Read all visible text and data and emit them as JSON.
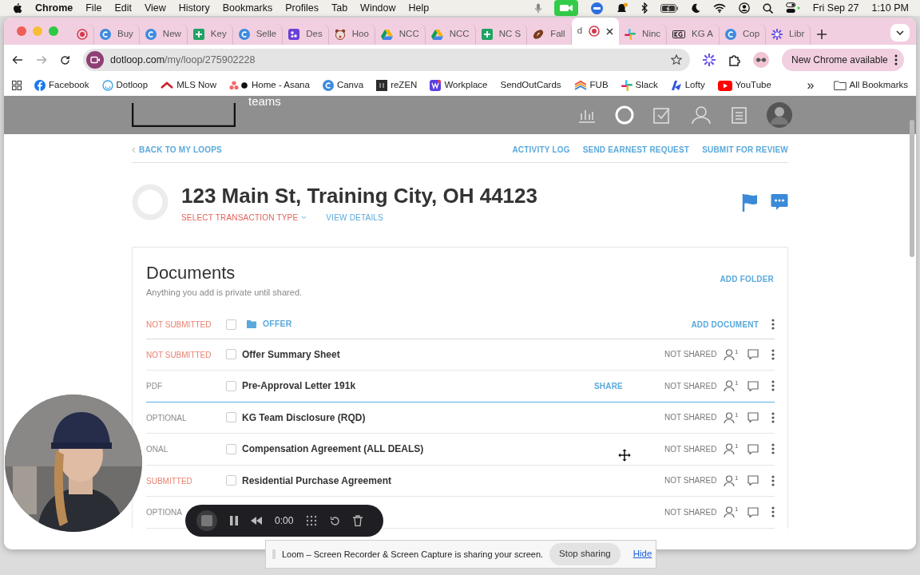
{
  "menu_bar": {
    "app": "Chrome",
    "menus": [
      "File",
      "Edit",
      "View",
      "History",
      "Bookmarks",
      "Profiles",
      "Tab",
      "Window",
      "Help"
    ],
    "date": "Fri Sep 27",
    "time": "1:10 PM"
  },
  "tabs": [
    {
      "kind": "record",
      "selected": false
    },
    {
      "kind": "canva",
      "title": "Buy",
      "selected": false
    },
    {
      "kind": "canva",
      "title": "New",
      "selected": false
    },
    {
      "kind": "sheets",
      "title": "Key",
      "selected": false
    },
    {
      "kind": "canva",
      "title": "Selle",
      "selected": false
    },
    {
      "kind": "apps",
      "title": "Des",
      "selected": false
    },
    {
      "kind": "bear",
      "title": "Hoo",
      "selected": false
    },
    {
      "kind": "drive",
      "title": "NCC",
      "selected": false
    },
    {
      "kind": "drive",
      "title": "NCC",
      "selected": false
    },
    {
      "kind": "sheets",
      "title": "NC S",
      "selected": false
    },
    {
      "kind": "football",
      "title": "Fall",
      "selected": false
    },
    {
      "kind": "record",
      "title": "d",
      "selected": true
    },
    {
      "kind": "slack",
      "title": "Ninc",
      "selected": false
    },
    {
      "kind": "kg",
      "title": "KG A",
      "selected": false
    },
    {
      "kind": "canva",
      "title": "Cop",
      "selected": false
    },
    {
      "kind": "sparkle",
      "title": "Libr",
      "selected": false
    }
  ],
  "toolbar": {
    "url_host": "dotloop.com",
    "url_path": "/my/loop/275902228",
    "update_button": "New Chrome available"
  },
  "bookmarks": [
    {
      "kind": "facebook",
      "label": "Facebook"
    },
    {
      "kind": "ring",
      "label": "Dotloop"
    },
    {
      "kind": "roof",
      "label": "MLS Now"
    },
    {
      "kind": "asana",
      "label": "Home - Asana"
    },
    {
      "kind": "canva",
      "label": "Canva"
    },
    {
      "kind": "rezen",
      "label": "reZEN"
    },
    {
      "kind": "workplace",
      "label": "Workplace"
    },
    {
      "kind": "none",
      "label": "SendOutCards"
    },
    {
      "kind": "fub",
      "label": "FUB"
    },
    {
      "kind": "slack",
      "label": "Slack"
    },
    {
      "kind": "lofty",
      "label": "Lofty"
    },
    {
      "kind": "youtube",
      "label": "YouTube"
    }
  ],
  "bookmarks_overflow": "»",
  "all_bookmarks": "All Bookmarks",
  "header": {
    "brand_suffix": "teams"
  },
  "loop": {
    "back": "BACK TO MY LOOPS",
    "actions": [
      "ACTIVITY LOG",
      "SEND EARNEST REQUEST",
      "SUBMIT FOR REVIEW"
    ],
    "title": "123 Main St, Training City, OH 44123",
    "transaction_type": "SELECT TRANSACTION TYPE",
    "view_details": "VIEW DETAILS"
  },
  "documents": {
    "title": "Documents",
    "subtitle": "Anything you add is private until shared.",
    "add_folder": "ADD FOLDER",
    "folder": {
      "status": "NOT SUBMITTED",
      "color": "#e8806f",
      "checked": false,
      "name": "OFFER",
      "add_document": "ADD DOCUMENT"
    },
    "rows": [
      {
        "status": "NOT SUBMITTED",
        "color": "#e8806f",
        "checked": false,
        "name": "Offer Summary Sheet",
        "share_state": "NOT SHARED",
        "participants": "1",
        "highlighted": false
      },
      {
        "status": "PDF",
        "color": "#8a8a8a",
        "checked": false,
        "name": "Pre-Approval Letter 191k",
        "share": "SHARE",
        "share_state": "NOT SHARED",
        "participants": "1",
        "highlighted": true
      },
      {
        "status": "OPTIONAL",
        "color": "#8a8a8a",
        "checked": false,
        "name": "KG Team Disclosure (RQD)",
        "share_state": "NOT SHARED",
        "participants": "1",
        "highlighted": false
      },
      {
        "status": "ONAL",
        "color": "#8a8a8a",
        "checked": false,
        "name": "Compensation Agreement (ALL DEALS)",
        "share_state": "NOT SHARED",
        "participants": "1",
        "highlighted": false
      },
      {
        "status": "SUBMITTED",
        "color": "#e8806f",
        "checked": false,
        "name": "Residential Purchase Agreement",
        "share_state": "NOT SHARED",
        "participants": "1",
        "highlighted": false
      },
      {
        "status": "OPTIONA",
        "color": "#8a8a8a",
        "share_state": "NOT SHARED",
        "participants": "1",
        "highlighted": false
      }
    ]
  },
  "loom": {
    "timer": "0:00",
    "notice": "Loom – Screen Recorder & Screen Capture is sharing your screen.",
    "stop_sharing": "Stop sharing",
    "hide": "Hide"
  }
}
